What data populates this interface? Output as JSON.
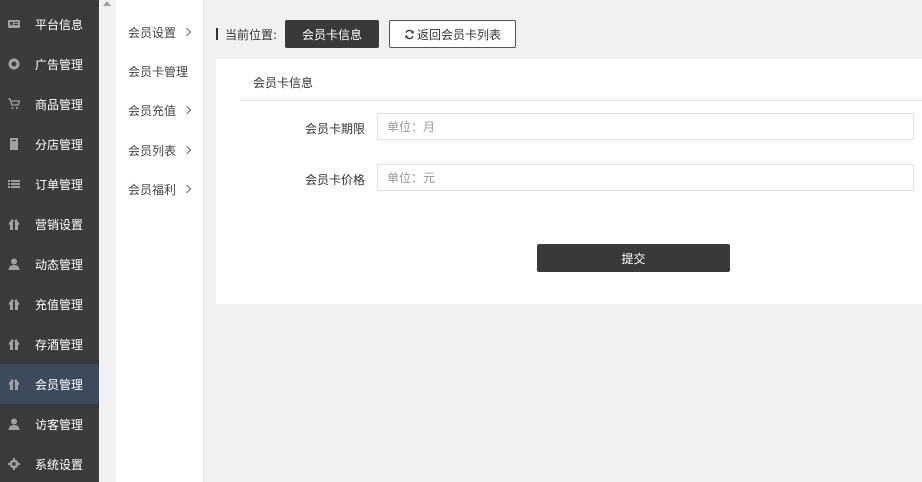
{
  "sidebar": {
    "items": [
      {
        "label": "平台信息",
        "icon": "newspaper-icon"
      },
      {
        "label": "广告管理",
        "icon": "lifebuoy-icon"
      },
      {
        "label": "商品管理",
        "icon": "cart-icon"
      },
      {
        "label": "分店管理",
        "icon": "book-icon"
      },
      {
        "label": "订单管理",
        "icon": "list-icon"
      },
      {
        "label": "营销设置",
        "icon": "gift-icon"
      },
      {
        "label": "动态管理",
        "icon": "user-icon"
      },
      {
        "label": "充值管理",
        "icon": "gift-icon"
      },
      {
        "label": "存酒管理",
        "icon": "gift-icon"
      },
      {
        "label": "会员管理",
        "icon": "gift-icon",
        "active": true
      },
      {
        "label": "访客管理",
        "icon": "user-icon"
      },
      {
        "label": "系统设置",
        "icon": "gear-icon"
      }
    ]
  },
  "submenu": {
    "items": [
      {
        "label": "会员设置",
        "has_arrow": true
      },
      {
        "label": "会员卡管理",
        "has_arrow": false
      },
      {
        "label": "会员充值",
        "has_arrow": true
      },
      {
        "label": "会员列表",
        "has_arrow": true
      },
      {
        "label": "会员福利",
        "has_arrow": true
      }
    ]
  },
  "breadcrumb": {
    "label": "当前位置:",
    "current": "会员卡信息",
    "back_button": "返回会员卡列表"
  },
  "panel": {
    "title": "会员卡信息",
    "fields": [
      {
        "label": "会员卡期限",
        "placeholder": "单位：月",
        "value": ""
      },
      {
        "label": "会员卡价格",
        "placeholder": "单位：元",
        "value": ""
      }
    ],
    "submit_label": "提交"
  },
  "colors": {
    "sidebar_bg": "#3b3b3b",
    "sidebar_active": "#3d4a5c",
    "button_dark": "#393939",
    "page_bg": "#f1f1f1"
  }
}
